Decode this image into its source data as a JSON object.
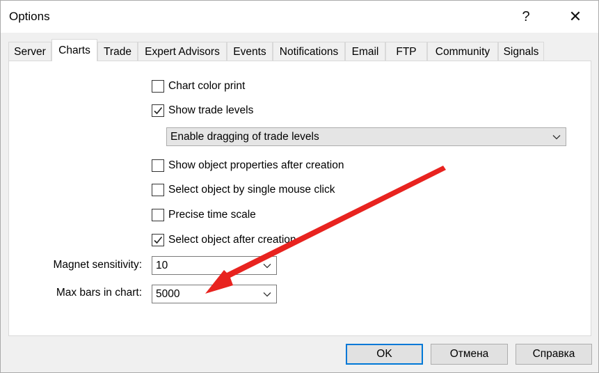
{
  "window": {
    "title": "Options",
    "help_glyph": "?",
    "close_glyph": "✕"
  },
  "tabs": [
    {
      "label": "Server"
    },
    {
      "label": "Charts"
    },
    {
      "label": "Trade"
    },
    {
      "label": "Expert Advisors"
    },
    {
      "label": "Events"
    },
    {
      "label": "Notifications"
    },
    {
      "label": "Email"
    },
    {
      "label": "FTP"
    },
    {
      "label": "Community"
    },
    {
      "label": "Signals"
    }
  ],
  "active_tab": "Charts",
  "options": {
    "chart_color_print": {
      "label": "Chart color print",
      "checked": false
    },
    "show_trade_levels": {
      "label": "Show trade levels",
      "checked": true
    },
    "trade_levels_mode": {
      "value": "Enable dragging of trade levels"
    },
    "show_object_properties": {
      "label": "Show object properties after creation",
      "checked": false
    },
    "select_single_click": {
      "label": "Select object by single mouse click",
      "checked": false
    },
    "precise_time_scale": {
      "label": "Precise time scale",
      "checked": false
    },
    "select_after_creation": {
      "label": "Select object after creation",
      "checked": true
    }
  },
  "fields": {
    "magnet": {
      "label": "Magnet sensitivity:",
      "value": "10"
    },
    "max_bars": {
      "label": "Max bars in chart:",
      "value": "5000"
    }
  },
  "buttons": {
    "ok": "OK",
    "cancel": "Отмена",
    "help": "Справка"
  },
  "colors": {
    "annotation_arrow": "#e8231f",
    "default_button_border": "#0078d7"
  }
}
